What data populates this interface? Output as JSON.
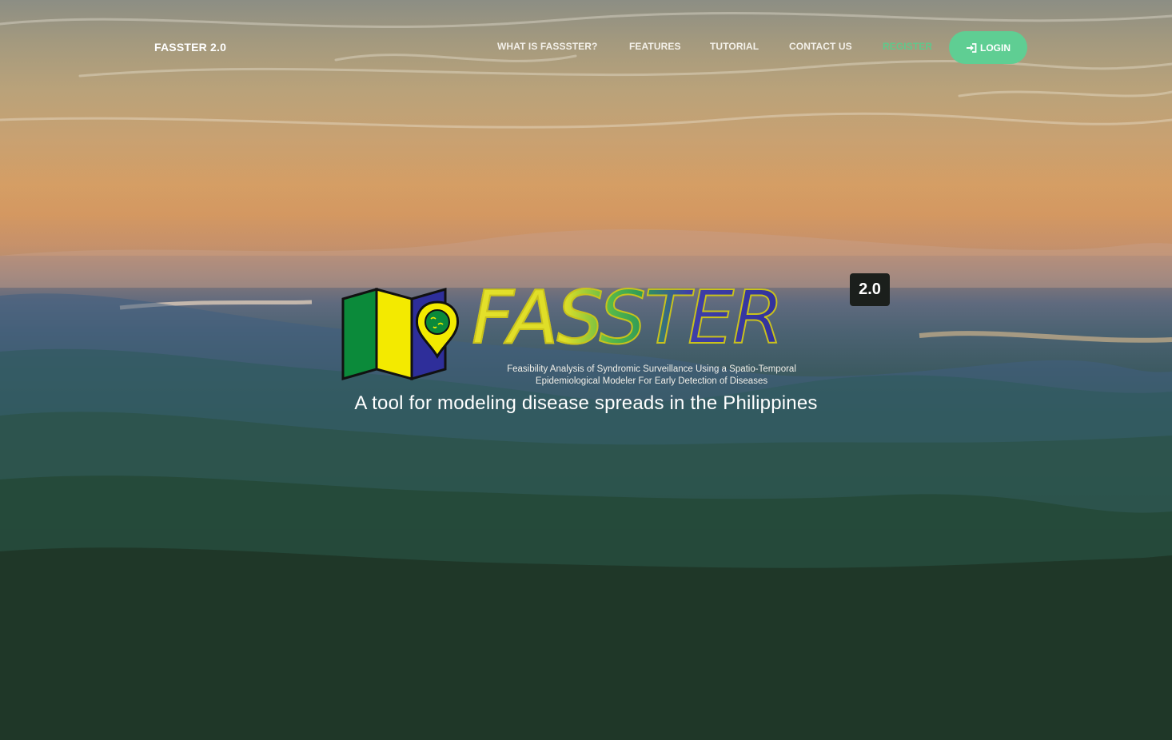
{
  "nav": {
    "brand": "FASSTER 2.0",
    "links": [
      {
        "label": "WHAT IS FASSSTER?"
      },
      {
        "label": "FEATURES"
      },
      {
        "label": "TUTORIAL"
      },
      {
        "label": "CONTACT US"
      },
      {
        "label": "REGISTER"
      }
    ],
    "login_label": "LOGIN",
    "login_icon": "sign-in-icon"
  },
  "hero": {
    "wordmark": "FASSTER",
    "version_badge": "2.0",
    "fullname_line1": "Feasibility  Analysis of Syndromic Surveillance Using a Spatio-Temporal",
    "fullname_line2": "Epidemiological Modeler For Early Detection of Diseases",
    "tagline": "A tool for modeling disease spreads in the Philippines"
  },
  "colors": {
    "accent_green": "#5fce93",
    "logo_green": "#0b8a3a",
    "logo_yellow": "#f3ea00",
    "logo_blue": "#2e2e9a"
  }
}
